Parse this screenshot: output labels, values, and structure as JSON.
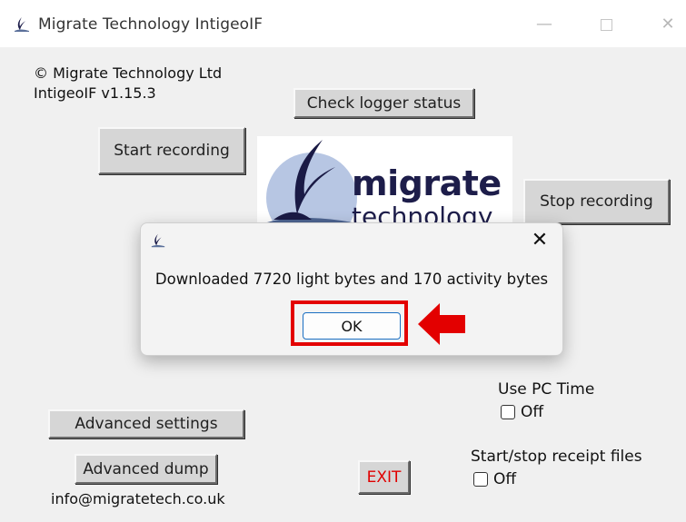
{
  "window": {
    "title": "Migrate Technology IntigeoIF",
    "controls": {
      "minimize": "—",
      "maximize": "",
      "close": "✕"
    }
  },
  "header": {
    "copyright": "© Migrate Technology Ltd",
    "version": "IntigeoIF v1.15.3"
  },
  "buttons": {
    "check_status": "Check logger status",
    "start_recording": "Start recording",
    "stop_recording": "Stop recording",
    "advanced_settings": "Advanced settings",
    "advanced_dump": "Advanced dump",
    "exit": "EXIT"
  },
  "logo": {
    "line1": "migrate",
    "line2": "technology"
  },
  "options": {
    "pc_time_label": "Use PC Time",
    "pc_time_state": "Off",
    "receipt_label": "Start/stop receipt files",
    "receipt_state": "Off"
  },
  "footer": {
    "email": "info@migratetech.co.uk"
  },
  "dialog": {
    "message": "Downloaded 7720 light bytes and 170 activity bytes",
    "ok_label": "OK",
    "close_glyph": "✕"
  },
  "colors": {
    "exit_text": "#e00000",
    "highlight": "#e30000",
    "ok_border": "#1a6fc2",
    "logo_navy": "#1d1d4a"
  }
}
